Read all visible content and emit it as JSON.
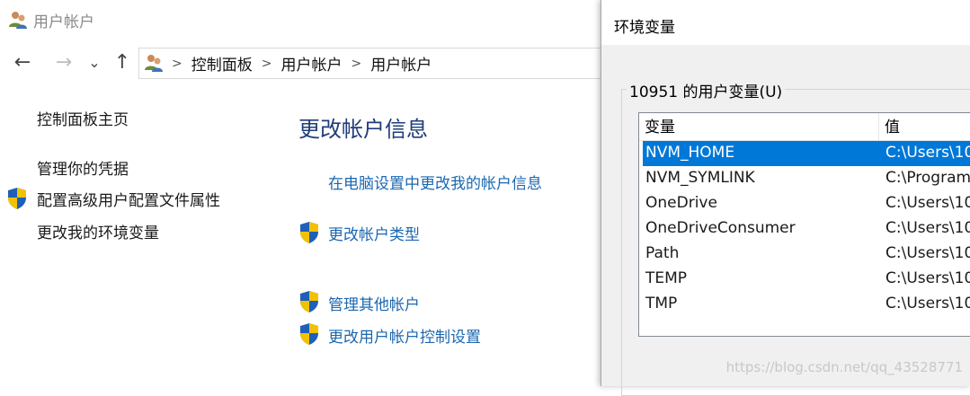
{
  "window": {
    "title": "用户帐户"
  },
  "nav": {
    "back": "←",
    "forward": "→",
    "recent": "⌄",
    "up": "↑"
  },
  "breadcrumb": [
    "控制面板",
    "用户帐户",
    "用户帐户"
  ],
  "sidebar": {
    "items": [
      {
        "label": "控制面板主页",
        "shield": false
      },
      {
        "label": "管理你的凭据",
        "shield": false
      },
      {
        "label": "配置高级用户配置文件属性",
        "shield": true
      },
      {
        "label": "更改我的环境变量",
        "shield": false
      }
    ]
  },
  "main": {
    "heading": "更改帐户信息",
    "links": [
      {
        "label": "在电脑设置中更改我的帐户信息",
        "shield": false
      },
      {
        "label": "更改帐户类型",
        "shield": true
      },
      {
        "label": "管理其他帐户",
        "shield": true
      },
      {
        "label": "更改用户帐户控制设置",
        "shield": true
      }
    ]
  },
  "dialog": {
    "title": "环境变量",
    "group_label": "10951 的用户变量(U)",
    "columns": [
      "变量",
      "值"
    ],
    "rows": [
      {
        "name": "NVM_HOME",
        "value": "C:\\Users\\10",
        "selected": true
      },
      {
        "name": "NVM_SYMLINK",
        "value": "C:\\Program",
        "selected": false
      },
      {
        "name": "OneDrive",
        "value": "C:\\Users\\10",
        "selected": false
      },
      {
        "name": "OneDriveConsumer",
        "value": "C:\\Users\\10",
        "selected": false
      },
      {
        "name": "Path",
        "value": "C:\\Users\\10",
        "selected": false
      },
      {
        "name": "TEMP",
        "value": "C:\\Users\\10",
        "selected": false
      },
      {
        "name": "TMP",
        "value": "C:\\Users\\10",
        "selected": false
      }
    ]
  },
  "watermark": "https://blog.csdn.net/qq_43528771",
  "colors": {
    "accent": "#0078d7",
    "link": "#1b67b0",
    "heading": "#1f3d7a"
  }
}
